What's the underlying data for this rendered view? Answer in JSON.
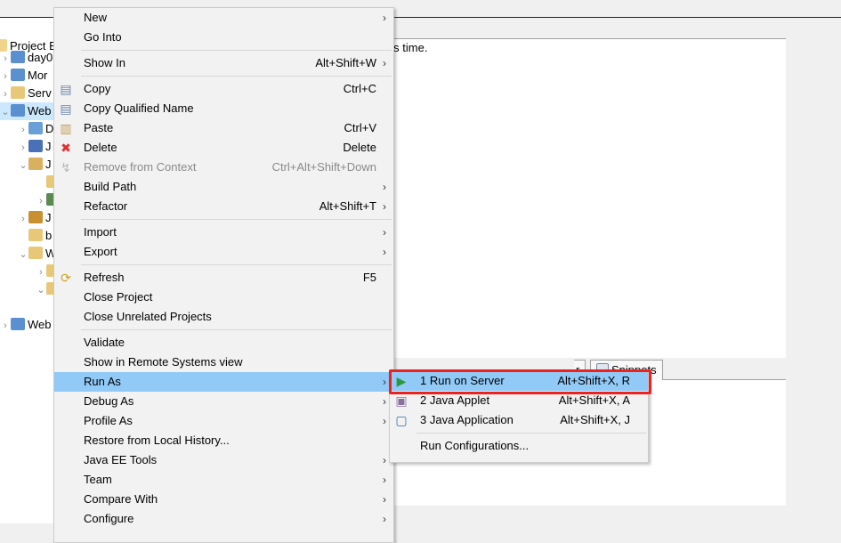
{
  "explorer": {
    "title": "Project E",
    "rows": [
      {
        "label": "day0",
        "chev": "›",
        "indent": 0,
        "color": "#5a8fd0"
      },
      {
        "label": "Mor",
        "chev": "›",
        "indent": 0,
        "color": "#5a8fd0"
      },
      {
        "label": "Serv",
        "chev": "›",
        "indent": 0,
        "color": "#e8c878"
      },
      {
        "label": "Web",
        "chev": "⌄",
        "indent": 0,
        "color": "#5a8fd0",
        "selected": true
      },
      {
        "label": "D",
        "chev": "›",
        "indent": 1,
        "color": "#6aa0d8"
      },
      {
        "label": "J",
        "chev": "›",
        "indent": 1,
        "color": "#4a70b8"
      },
      {
        "label": "J",
        "chev": "⌄",
        "indent": 1,
        "color": "#d8b060"
      },
      {
        "label": "",
        "chev": "",
        "indent": 2,
        "color": "#e8c878"
      },
      {
        "label": "",
        "chev": "›",
        "indent": 2,
        "color": "#5a8a50"
      },
      {
        "label": "J",
        "chev": "›",
        "indent": 1,
        "color": "#c89030"
      },
      {
        "label": "b",
        "chev": "",
        "indent": 1,
        "color": "#e8c878"
      },
      {
        "label": "W",
        "chev": "⌄",
        "indent": 1,
        "color": "#e8c878"
      },
      {
        "label": "",
        "chev": "›",
        "indent": 2,
        "color": "#e8c878"
      },
      {
        "label": "",
        "chev": "⌄",
        "indent": 2,
        "color": "#e8c878"
      },
      {
        "label": "",
        "chev": "",
        "indent": 0,
        "color": "",
        "blank": true
      },
      {
        "label": "Web",
        "chev": "›",
        "indent": 0,
        "color": "#5a8fd0"
      }
    ]
  },
  "main": {
    "message": "splay at this time.",
    "tabs": [
      {
        "label": "r"
      },
      {
        "label": "Snippets",
        "icon": "snippets-icon"
      }
    ]
  },
  "context_menu": {
    "items": [
      {
        "label": "New",
        "submenu": true
      },
      {
        "label": "Go Into"
      },
      {
        "sep": true
      },
      {
        "label": "Show In",
        "shortcut": "Alt+Shift+W",
        "submenu": true
      },
      {
        "sep": true
      },
      {
        "label": "Copy",
        "shortcut": "Ctrl+C",
        "icon": "copy-icon"
      },
      {
        "label": "Copy Qualified Name",
        "icon": "copy-qualified-name-icon"
      },
      {
        "label": "Paste",
        "shortcut": "Ctrl+V",
        "icon": "paste-icon"
      },
      {
        "label": "Delete",
        "shortcut": "Delete",
        "icon": "delete-icon"
      },
      {
        "label": "Remove from Context",
        "shortcut": "Ctrl+Alt+Shift+Down",
        "icon": "remove-context-icon",
        "disabled": true
      },
      {
        "label": "Build Path",
        "submenu": true
      },
      {
        "label": "Refactor",
        "shortcut": "Alt+Shift+T",
        "submenu": true
      },
      {
        "sep": true
      },
      {
        "label": "Import",
        "submenu": true
      },
      {
        "label": "Export",
        "submenu": true
      },
      {
        "sep": true
      },
      {
        "label": "Refresh",
        "shortcut": "F5",
        "icon": "refresh-icon"
      },
      {
        "label": "Close Project"
      },
      {
        "label": "Close Unrelated Projects"
      },
      {
        "sep": true
      },
      {
        "label": "Validate"
      },
      {
        "label": "Show in Remote Systems view"
      },
      {
        "label": "Run As",
        "submenu": true,
        "highlighted": true
      },
      {
        "label": "Debug As",
        "submenu": true
      },
      {
        "label": "Profile As",
        "submenu": true
      },
      {
        "label": "Restore from Local History..."
      },
      {
        "label": "Java EE Tools",
        "submenu": true
      },
      {
        "label": "Team",
        "submenu": true
      },
      {
        "label": "Compare With",
        "submenu": true
      },
      {
        "label": "Configure",
        "submenu": true
      }
    ]
  },
  "run_as_submenu": {
    "items": [
      {
        "label": "1 Run on Server",
        "shortcut": "Alt+Shift+X, R",
        "icon": "run-on-server-icon",
        "highlighted": true
      },
      {
        "label": "2 Java Applet",
        "shortcut": "Alt+Shift+X, A",
        "icon": "java-applet-icon"
      },
      {
        "label": "3 Java Application",
        "shortcut": "Alt+Shift+X, J",
        "icon": "java-application-icon"
      },
      {
        "sep": true
      },
      {
        "label": "Run Configurations..."
      }
    ]
  },
  "colors": {
    "highlight": "#91c9f7",
    "annotation": "#f0201c",
    "menu_bg": "#f2f2f2"
  }
}
